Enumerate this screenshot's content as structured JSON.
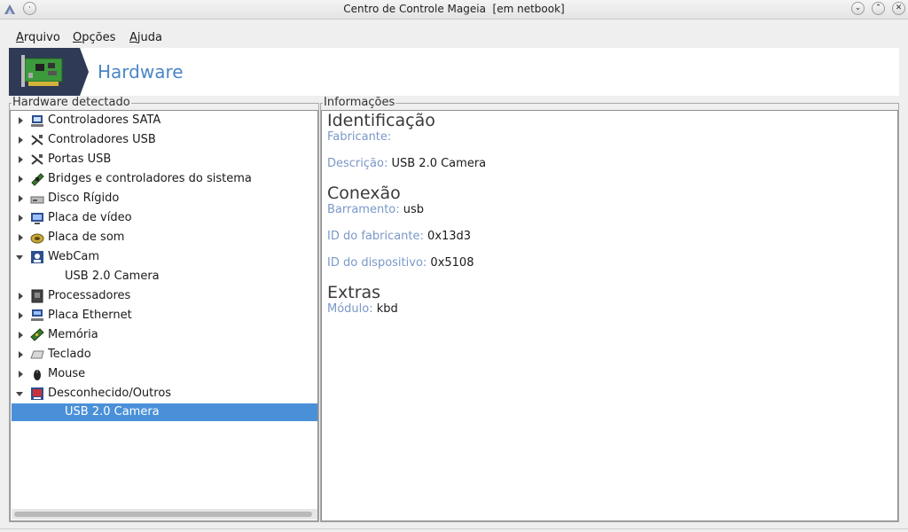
{
  "window": {
    "title": "Centro de Controle Mageia  [em netbook]",
    "buttons": {
      "minimize": "⌄",
      "maximize": "⌃",
      "close": "✕"
    }
  },
  "menu": [
    {
      "label": "Arquivo"
    },
    {
      "label": "Opções"
    },
    {
      "label": "Ajuda"
    }
  ],
  "banner": {
    "title": "Hardware",
    "logo_icon": "pci-card-icon"
  },
  "left_panel": {
    "label": "Hardware detectado",
    "tree": [
      {
        "label": "Controladores SATA",
        "icon": "sata-controller-icon",
        "expanded": false
      },
      {
        "label": "Controladores USB",
        "icon": "usb-controller-icon",
        "expanded": false
      },
      {
        "label": "Portas USB",
        "icon": "usb-port-icon",
        "expanded": false
      },
      {
        "label": "Bridges e controladores do sistema",
        "icon": "bridge-icon",
        "expanded": false
      },
      {
        "label": "Disco Rígido",
        "icon": "hard-disk-icon",
        "expanded": false
      },
      {
        "label": "Placa de vídeo",
        "icon": "video-card-icon",
        "expanded": false
      },
      {
        "label": "Placa de som",
        "icon": "sound-card-icon",
        "expanded": false
      },
      {
        "label": "WebCam",
        "icon": "webcam-icon",
        "expanded": true,
        "children": [
          "USB 2.0 Camera"
        ]
      },
      {
        "label": "Processadores",
        "icon": "processor-icon",
        "expanded": false
      },
      {
        "label": "Placa Ethernet",
        "icon": "ethernet-icon",
        "expanded": false
      },
      {
        "label": "Memória",
        "icon": "memory-icon",
        "expanded": false
      },
      {
        "label": "Teclado",
        "icon": "keyboard-icon",
        "expanded": false
      },
      {
        "label": "Mouse",
        "icon": "mouse-icon",
        "expanded": false
      },
      {
        "label": "Desconhecido/Outros",
        "icon": "unknown-device-icon",
        "expanded": true,
        "children": [
          "USB 2.0 Camera"
        ],
        "selected_child": 0
      }
    ]
  },
  "right_panel": {
    "label": "Informações",
    "sections": [
      {
        "heading": "Identificação",
        "fields": [
          {
            "key": "Fabricante:",
            "value": ""
          },
          {
            "key": "Descrição:",
            "value": "USB 2.0 Camera"
          }
        ]
      },
      {
        "heading": "Conexão",
        "fields": [
          {
            "key": "Barramento:",
            "value": "usb"
          },
          {
            "key": "ID do fabricante:",
            "value": "0x13d3"
          },
          {
            "key": "ID do dispositivo:",
            "value": "0x5108"
          }
        ]
      },
      {
        "heading": "Extras",
        "fields": [
          {
            "key": "Módulo:",
            "value": "kbd"
          }
        ]
      }
    ]
  },
  "colors": {
    "selection": "#4a90d9",
    "banner_title": "#4a86c7",
    "field_key": "#7a98c8"
  }
}
